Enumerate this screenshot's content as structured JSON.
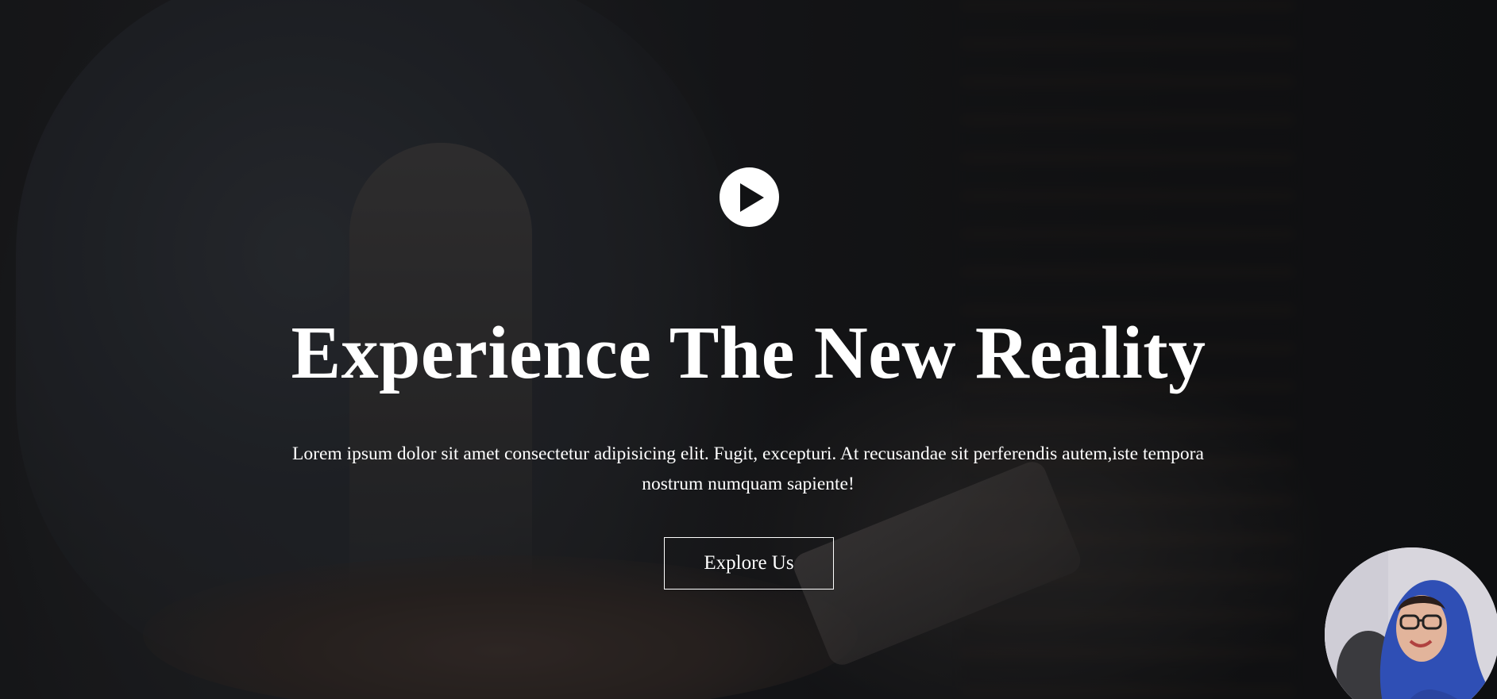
{
  "hero": {
    "title": "Experience The New Reality",
    "description": "Lorem ipsum dolor sit amet consectetur adipisicing elit. Fugit, excepturi. At recusandae sit perferendis autem,iste tempora nostrum numquam sapiente!",
    "cta_label": "Explore Us",
    "play_icon": "play-icon"
  },
  "colors": {
    "text": "#ffffff",
    "overlay": "#0a0b0d",
    "button_border": "#ffffff",
    "hijab": "#2f4fb5"
  }
}
